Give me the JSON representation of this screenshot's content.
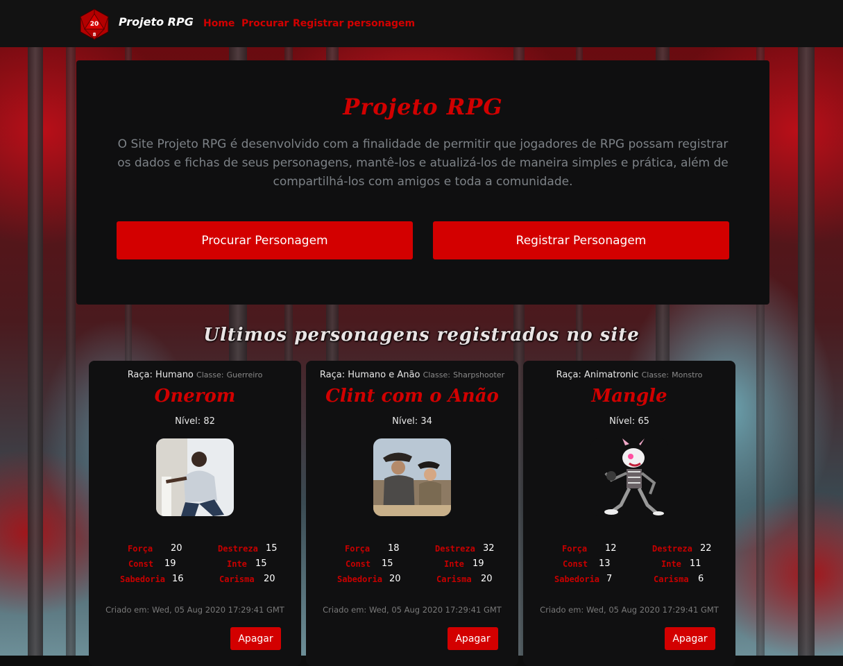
{
  "navbar": {
    "brand": "Projeto RPG",
    "links": [
      "Home",
      "Procurar",
      "Registrar personagem"
    ],
    "logo_text": "20",
    "logo_sub": "8"
  },
  "hero": {
    "title": "Projeto RPG",
    "description": "O Site Projeto RPG é desenvolvido com a finalidade de permitir que jogadores de RPG possam registrar os dados e fichas de seus personagens, mantê-los e atualizá-los de maneira simples e prática, além de compartilhá-los com amigos e toda a comunidade.",
    "search_button": "Procurar Personagem",
    "register_button": "Registrar Personagem"
  },
  "section_title": "Ultimos personagens registrados no site",
  "labels": {
    "race": "Raça:",
    "class": "Classe:",
    "level": "Nível:",
    "strength": "Força",
    "dexterity": "Destreza",
    "constitution": "Const",
    "intelligence": "Inte",
    "wisdom": "Sabedoria",
    "charisma": "Carisma",
    "delete": "Apagar"
  },
  "characters": [
    {
      "race": "Humano",
      "class": "Guerreiro",
      "name": "Onerom",
      "level": "82",
      "strength": "20",
      "dexterity": "15",
      "constitution": "19",
      "intelligence": "15",
      "wisdom": "16",
      "charisma": "20",
      "created": "Criado em: Wed, 05 Aug 2020 17:29:41 GMT"
    },
    {
      "race": "Humano e Anão",
      "class": "Sharpshooter",
      "name": "Clint com o Anão",
      "level": "34",
      "strength": "18",
      "dexterity": "32",
      "constitution": "15",
      "intelligence": "19",
      "wisdom": "20",
      "charisma": "20",
      "created": "Criado em: Wed, 05 Aug 2020 17:29:41 GMT"
    },
    {
      "race": "Animatronic",
      "class": "Monstro",
      "name": "Mangle",
      "level": "65",
      "strength": "12",
      "dexterity": "22",
      "constitution": "13",
      "intelligence": "11",
      "wisdom": "7",
      "charisma": "6",
      "created": "Criado em: Wed, 05 Aug 2020 17:29:41 GMT"
    }
  ],
  "colors": {
    "accent": "#d30000",
    "panel": "#0f0f10",
    "navbar": "#121212"
  }
}
